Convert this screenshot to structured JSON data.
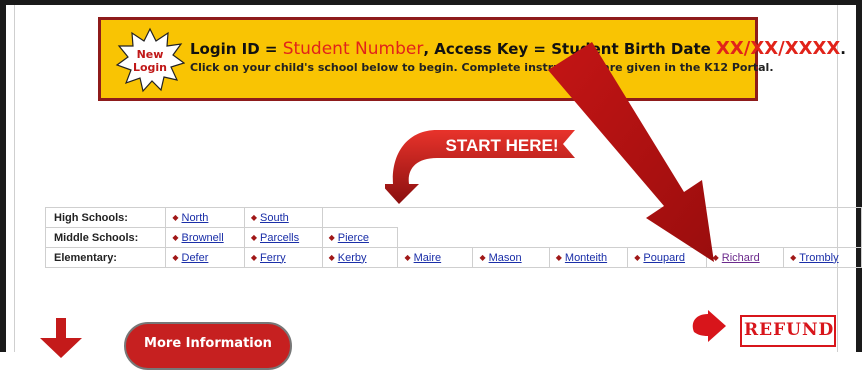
{
  "banner": {
    "badge_text_1": "New",
    "badge_text_2": "Login",
    "line1_prefix": "Login ID = ",
    "line1_student_number": "Student Number",
    "line1_middle": ", Access Key = Student Birth Date ",
    "line1_date": "XX/XX/XXXX",
    "line1_end": ".",
    "line2": "Click on your child's school below to begin.  Complete instructions are given in the K12 Portal."
  },
  "start_here": "START HERE!",
  "schools": {
    "high_label": "High Schools:",
    "high": [
      "North",
      "South"
    ],
    "middle_label": "Middle Schools:",
    "middle": [
      "Brownell",
      "Parcells",
      "Pierce"
    ],
    "elementary_label": "Elementary:",
    "elementary": [
      "Defer",
      "Ferry",
      "Kerby",
      "Maire",
      "Mason",
      "Monteith",
      "Poupard",
      "Richard",
      "Trombly"
    ]
  },
  "more_info_label": "More Information",
  "refund_label": "REFUND",
  "colors": {
    "banner_bg": "#f9c403",
    "banner_border": "#8e1b1b",
    "accent_red": "#e1231a",
    "link_blue": "#1a2ea8"
  }
}
